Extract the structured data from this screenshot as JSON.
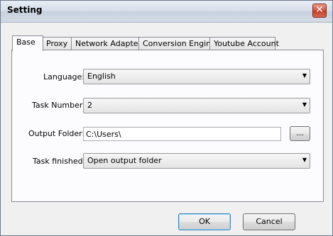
{
  "window": {
    "title": "Setting",
    "close_glyph": "✕"
  },
  "tabs": [
    {
      "label": "Base",
      "active": true
    },
    {
      "label": "Proxy"
    },
    {
      "label": "Network Adapter"
    },
    {
      "label": "Conversion Engine"
    },
    {
      "label": "Youtube Account"
    }
  ],
  "base": {
    "language": {
      "label": "Language:",
      "value": "English"
    },
    "task_number": {
      "label": "Task Number:",
      "value": "2"
    },
    "output_folder": {
      "label": "Output Folder:",
      "value": "C:\\Users\\",
      "browse_label": "..."
    },
    "task_finished": {
      "label": "Task finished:",
      "value": "Open output folder"
    }
  },
  "buttons": {
    "ok": "OK",
    "cancel": "Cancel"
  },
  "icons": {
    "dropdown": "chevron-down-icon",
    "close": "close-icon"
  }
}
